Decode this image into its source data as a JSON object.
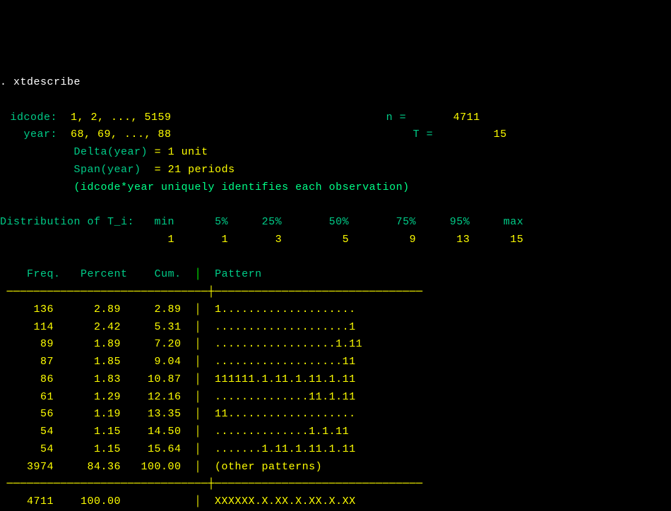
{
  "command_line": ". xtdescribe",
  "panel_info": {
    "id_name": "idcode:",
    "id_range": "1, 2, ..., 5159",
    "time_name": "year:",
    "time_range": "68, 69, ..., 88",
    "n_label": "n =",
    "n_value": "4711",
    "T_label": "T =",
    "T_value": "15",
    "delta_label": "Delta(year)",
    "delta_value": "= 1 unit",
    "span_label": "Span(year)",
    "span_value": "= 21 periods",
    "unique_note": "(idcode*year uniquely identifies each observation)"
  },
  "dist_header": "Distribution of T_i:",
  "dist_labels": {
    "min": "min",
    "p5": "5%",
    "p25": "25%",
    "p50": "50%",
    "p75": "75%",
    "p95": "95%",
    "max": "max"
  },
  "dist_values": {
    "min": "1",
    "p5": "1",
    "p25": "3",
    "p50": "5",
    "p75": "9",
    "p95": "13",
    "max": "15"
  },
  "table_header": {
    "freq": "Freq.",
    "percent": "Percent",
    "cum": "Cum.",
    "pattern": "Pattern"
  },
  "rows": [
    {
      "freq": "136",
      "percent": "2.89",
      "cum": "2.89",
      "pattern": "1...................."
    },
    {
      "freq": "114",
      "percent": "2.42",
      "cum": "5.31",
      "pattern": "....................1"
    },
    {
      "freq": "89",
      "percent": "1.89",
      "cum": "7.20",
      "pattern": "..................1.11"
    },
    {
      "freq": "87",
      "percent": "1.85",
      "cum": "9.04",
      "pattern": "...................11"
    },
    {
      "freq": "86",
      "percent": "1.83",
      "cum": "10.87",
      "pattern": "111111.1.11.1.11.1.11"
    },
    {
      "freq": "61",
      "percent": "1.29",
      "cum": "12.16",
      "pattern": "..............11.1.11"
    },
    {
      "freq": "56",
      "percent": "1.19",
      "cum": "13.35",
      "pattern": "11..................."
    },
    {
      "freq": "54",
      "percent": "1.15",
      "cum": "14.50",
      "pattern": "..............1.1.11"
    },
    {
      "freq": "54",
      "percent": "1.15",
      "cum": "15.64",
      "pattern": ".......1.11.1.11.1.11"
    },
    {
      "freq": "3974",
      "percent": "84.36",
      "cum": "100.00",
      "pattern": "(other patterns)"
    }
  ],
  "total": {
    "freq": "4711",
    "percent": "100.00",
    "cum": "",
    "pattern": "XXXXXX.X.XX.X.XX.X.XX"
  },
  "hr_above": " ──────────────────────────────┼───────────────────────────────",
  "hr_below": " ──────────────────────────────┼───────────────────────────────"
}
